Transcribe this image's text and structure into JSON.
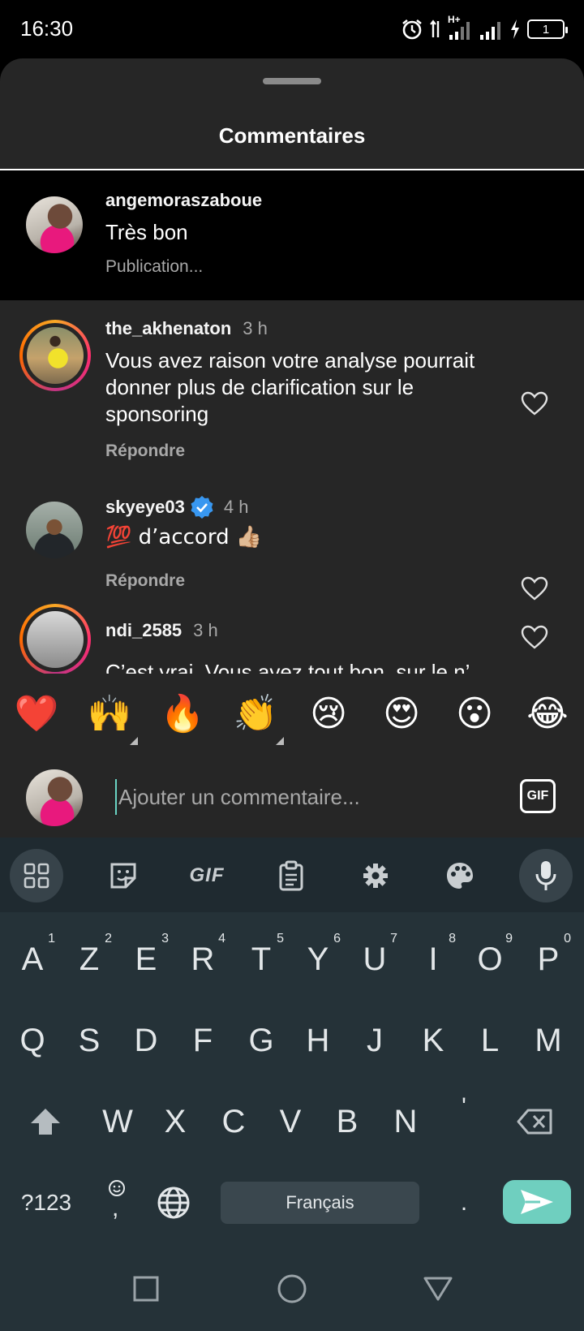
{
  "status_bar": {
    "time": "16:30",
    "network_label": "H+",
    "battery_level": "1",
    "icons": [
      "alarm-icon",
      "data-arrows-icon",
      "signal-icon",
      "signal-icon",
      "charging-icon",
      "battery-icon"
    ]
  },
  "sheet": {
    "title": "Commentaires"
  },
  "caption": {
    "username": "angemoraszaboue",
    "text": "Très bon",
    "status": "Publication..."
  },
  "comments": [
    {
      "username": "the_akhenaton",
      "time": "3 h",
      "text_lines": [
        "Vous avez raison votre analyse pourrait",
        "donner plus de clarification sur le",
        "sponsoring"
      ],
      "reply_label": "Répondre",
      "story_ring": true
    },
    {
      "username": "skyeye03",
      "time": "4 h",
      "verified": true,
      "text": "💯 d’accord 👍🏼",
      "reply_label": "Répondre",
      "story_ring": false
    },
    {
      "username": "ndi_2585",
      "time": "3 h",
      "text": "C’est vrai. Vous avez tout bon, sur le n’",
      "story_ring": true
    }
  ],
  "emoji_bar": [
    "❤️",
    "🙌",
    "🔥",
    "👏",
    "😢",
    "😍",
    "😮",
    "😂"
  ],
  "input": {
    "placeholder": "Ajouter un commentaire...",
    "gif_label": "GIF"
  },
  "keyboard": {
    "toolbar": [
      "apps-grid-icon",
      "sticker-icon",
      "GIF",
      "clipboard-icon",
      "gear-icon",
      "palette-icon",
      "mic-icon"
    ],
    "row1": [
      {
        "key": "A",
        "hint": "1"
      },
      {
        "key": "Z",
        "hint": "2"
      },
      {
        "key": "E",
        "hint": "3"
      },
      {
        "key": "R",
        "hint": "4"
      },
      {
        "key": "T",
        "hint": "5"
      },
      {
        "key": "Y",
        "hint": "6"
      },
      {
        "key": "U",
        "hint": "7"
      },
      {
        "key": "I",
        "hint": "8"
      },
      {
        "key": "O",
        "hint": "9"
      },
      {
        "key": "P",
        "hint": "0"
      }
    ],
    "row2": [
      "Q",
      "S",
      "D",
      "F",
      "G",
      "H",
      "J",
      "K",
      "L",
      "M"
    ],
    "row3": [
      "W",
      "X",
      "C",
      "V",
      "B",
      "N",
      "'"
    ],
    "symbols_label": "?123",
    "emoji_comma_label": ",",
    "space_label": "Français",
    "period_label": "."
  },
  "nav_bar": [
    "recents-square-icon",
    "home-circle-icon",
    "back-triangle-icon"
  ]
}
